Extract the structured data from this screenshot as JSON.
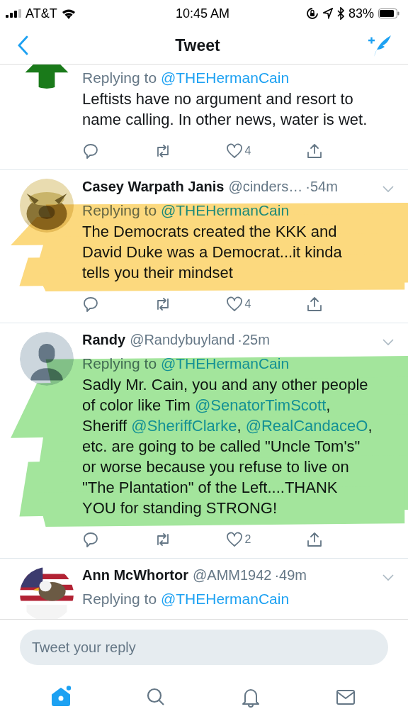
{
  "status_bar": {
    "carrier": "AT&T",
    "time": "10:45 AM",
    "battery": "83%"
  },
  "header": {
    "title": "Tweet"
  },
  "tweets": [
    {
      "default_avatar": false,
      "reply_prefix": "Replying to ",
      "reply_to": "@THEHermanCain",
      "body": [
        {
          "kind": "text",
          "text": "Leftists have no argument and resort to name calling.  In other news, water is wet."
        }
      ],
      "actions": {
        "likes": "4"
      }
    },
    {
      "default_avatar": false,
      "name": "Casey Warpath Janis",
      "handle": "@cinders…",
      "time": "·54m",
      "reply_prefix": "Replying to ",
      "reply_to": "@THEHermanCain",
      "body": [
        {
          "kind": "text",
          "text": "The Democrats created the KKK and David Duke was a Democrat...it kinda tells you their mindset"
        }
      ],
      "actions": {
        "likes": "4"
      },
      "highlight": {
        "color": "#fcd97e"
      }
    },
    {
      "default_avatar": true,
      "name": "Randy",
      "handle": "@Randybuyland",
      "time": "·25m",
      "reply_prefix": "Replying to ",
      "reply_to": "@THEHermanCain",
      "body": [
        {
          "kind": "text",
          "text": "Sadly Mr. Cain, you and any other people of color like Tim "
        },
        {
          "kind": "link",
          "text": "@SenatorTimScott"
        },
        {
          "kind": "text",
          "text": ", Sheriff "
        },
        {
          "kind": "link",
          "text": "@SheriffClarke"
        },
        {
          "kind": "text",
          "text": ", "
        },
        {
          "kind": "link",
          "text": "@RealCandaceO"
        },
        {
          "kind": "text",
          "text": ", etc. are going to be called \"Uncle Tom's\" or worse because you refuse to live on \"The Plantation\" of the Left....THANK YOU for standing STRONG!"
        }
      ],
      "actions": {
        "likes": "2"
      },
      "highlight": {
        "color": "#a3e59c"
      }
    },
    {
      "default_avatar": false,
      "name": "Ann McWhortor",
      "handle": "@AMM1942",
      "time": "·49m",
      "reply_prefix": "Replying to ",
      "reply_to": "@THEHermanCain"
    }
  ],
  "reply_field": {
    "placeholder": "Tweet your reply"
  },
  "tab_bar": [
    {
      "kind": "home",
      "selected": true,
      "badge": true
    },
    {
      "kind": "search",
      "selected": false,
      "badge": false
    },
    {
      "kind": "notifications",
      "selected": false,
      "badge": false
    },
    {
      "kind": "messages",
      "selected": false,
      "badge": false
    }
  ]
}
